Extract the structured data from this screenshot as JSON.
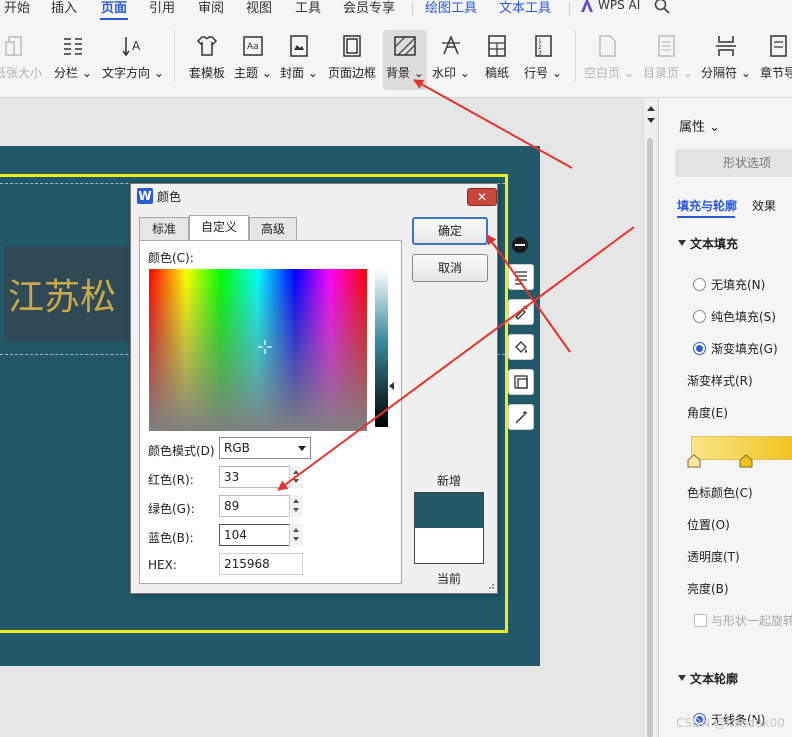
{
  "menu": {
    "tabs": [
      "开始",
      "插入",
      "页面",
      "引用",
      "审阅",
      "视图",
      "工具",
      "会员专享",
      "绘图工具",
      "文本工具"
    ],
    "active": "页面",
    "wps_ai": "WPS AI"
  },
  "ribbon": {
    "paper_size": "纸张大小",
    "columns": "分栏",
    "text_direction": "文字方向",
    "template": "套模板",
    "theme": "主题",
    "cover": "封面",
    "page_border": "页面边框",
    "background": "背景",
    "watermark": "水印",
    "manuscript": "稿纸",
    "line_number": "行号",
    "blank_page": "空白页",
    "toc_page": "目录页",
    "separator": "分隔符",
    "section": "章节导"
  },
  "document": {
    "textbox_text": "江苏松",
    "page_color": "#215968",
    "frame_color": "#f0ee1e"
  },
  "dialog": {
    "title": "颜色",
    "icon": "W",
    "close": "✕",
    "tabs": [
      "标准",
      "自定义",
      "高级"
    ],
    "active_tab": "自定义",
    "color_label": "颜色(C):",
    "mode_label": "颜色模式(D)",
    "mode_value": "RGB",
    "red_label": "红色(R):",
    "red_value": "33",
    "green_label": "绿色(G):",
    "green_value": "89",
    "blue_label": "蓝色(B):",
    "blue_value": "104",
    "hex_label": "HEX:",
    "hex_value": "215968",
    "ok": "确定",
    "cancel": "取消",
    "new_label": "新增",
    "current_label": "当前",
    "new_color": "#215968",
    "current_color": "#ffffff"
  },
  "panel": {
    "title": "属性",
    "shape_options": "形状选项",
    "tab_fill": "填充与轮廓",
    "tab_effect": "效果",
    "section_fill": "文本填充",
    "no_fill": "无填充(N)",
    "solid_fill": "纯色填充(S)",
    "gradient_fill": "渐变填充(G)",
    "gradient_style": "渐变样式(R)",
    "angle": "角度(E)",
    "stop_color": "色标颜色(C)",
    "position": "位置(O)",
    "transparency": "透明度(T)",
    "brightness": "亮度(B)",
    "rotate_with_shape": "与形状一起旋转",
    "section_outline": "文本轮廓",
    "no_line": "无线条(N)"
  },
  "watermark_text": "CSDN @kaoduk00",
  "colors": {
    "accent": "#2a5bd7",
    "arrow": "#e8312a",
    "gradient_start": "#f9e58a",
    "gradient_end": "#f0c21a"
  }
}
